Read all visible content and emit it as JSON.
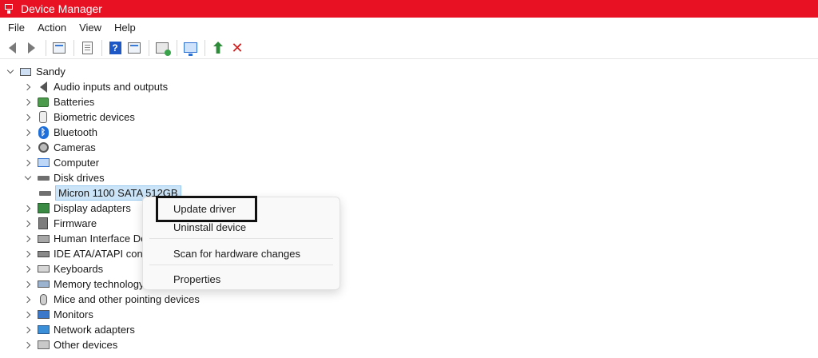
{
  "window": {
    "title": "Device Manager",
    "accent": "#e81123",
    "icon": "device-manager-icon"
  },
  "menu": [
    "File",
    "Action",
    "View",
    "Help"
  ],
  "toolbar": {
    "buttons": [
      "back-icon",
      "forward-icon",
      "properties-pane-icon",
      "document-icon",
      "help-icon",
      "action-pane-icon",
      "scan-hardware-icon",
      "monitor-icon",
      "update-driver-icon",
      "uninstall-icon"
    ]
  },
  "tree": {
    "root": "Sandy",
    "items": [
      {
        "label": "Audio inputs and outputs",
        "icon": "speaker-icon"
      },
      {
        "label": "Batteries",
        "icon": "battery-icon"
      },
      {
        "label": "Biometric devices",
        "icon": "biometric-icon"
      },
      {
        "label": "Bluetooth",
        "icon": "bluetooth-icon"
      },
      {
        "label": "Cameras",
        "icon": "camera-icon"
      },
      {
        "label": "Computer",
        "icon": "computer-icon"
      },
      {
        "label": "Disk drives",
        "icon": "disk-drive-icon",
        "expanded": true,
        "children": [
          "Micron 1100 SATA 512GB"
        ]
      },
      {
        "label": "Display adapters",
        "icon": "display-adapter-icon"
      },
      {
        "label": "Firmware",
        "icon": "firmware-icon"
      },
      {
        "label": "Human Interface De",
        "icon": "hid-icon"
      },
      {
        "label": "IDE ATA/ATAPI contro",
        "icon": "ide-controller-icon"
      },
      {
        "label": "Keyboards",
        "icon": "keyboard-icon"
      },
      {
        "label": "Memory technology",
        "icon": "memory-icon"
      },
      {
        "label": "Mice and other pointing devices",
        "icon": "mouse-icon"
      },
      {
        "label": "Monitors",
        "icon": "monitor-icon"
      },
      {
        "label": "Network adapters",
        "icon": "network-adapter-icon"
      },
      {
        "label": "Other devices",
        "icon": "other-devices-icon"
      }
    ]
  },
  "context_menu": {
    "items": [
      "Update driver",
      "Uninstall device",
      "Scan for hardware changes",
      "Properties"
    ],
    "highlighted": "Update driver"
  }
}
